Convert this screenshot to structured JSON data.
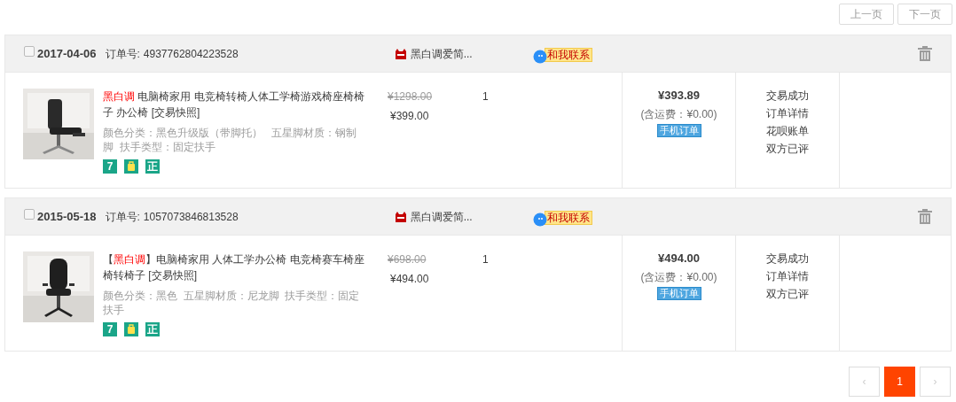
{
  "pager_top": {
    "prev": "上一页",
    "next": "下一页"
  },
  "orders": [
    {
      "checked": false,
      "date": "2017-04-06",
      "order_no_label": "订单号:",
      "order_no": "4937762804223528",
      "shop": "黑白调爱简...",
      "contact": "和我联系",
      "item": {
        "title": {
          "brand": "黑白调",
          "after": " 电脑椅家用 电竞椅转椅人体工学椅游戏椅座椅椅子 办公椅 [交易快照]"
        },
        "specs": "颜色分类：黑色升级版（带脚托）   五星脚材质：钢制脚  扶手类型：固定扶手",
        "services": [
          {
            "kind": "text",
            "label": "7"
          },
          {
            "kind": "bag"
          },
          {
            "kind": "text",
            "label": "正"
          }
        ],
        "original_price": "¥1298.00",
        "price": "¥399.00",
        "qty": "1"
      },
      "total": "¥393.89",
      "shipping": "(含运费：¥0.00)",
      "badge": "手机订单",
      "actions": [
        "交易成功",
        "订单详情",
        "花呗账单",
        "双方已评"
      ]
    },
    {
      "checked": false,
      "date": "2015-05-18",
      "order_no_label": "订单号:",
      "order_no": "1057073846813528",
      "shop": "黑白调爱简...",
      "contact": "和我联系",
      "item": {
        "title": {
          "before": "【",
          "brand": "黑白调",
          "after": "】电脑椅家用 人体工学办公椅 电竞椅赛车椅座椅转椅子 [交易快照]"
        },
        "specs": "颜色分类：黑色  五星脚材质：尼龙脚  扶手类型：固定扶手",
        "services": [
          {
            "kind": "text",
            "label": "7"
          },
          {
            "kind": "bag"
          },
          {
            "kind": "text",
            "label": "正"
          }
        ],
        "original_price": "¥698.00",
        "price": "¥494.00",
        "qty": "1"
      },
      "total": "¥494.00",
      "shipping": "(含运费：¥0.00)",
      "badge": "手机订单",
      "actions": [
        "交易成功",
        "订单详情",
        "双方已评"
      ]
    }
  ],
  "pager_bottom": [
    {
      "label": "‹",
      "selected": false
    },
    {
      "label": "1",
      "selected": true
    },
    {
      "label": "›",
      "selected": false
    }
  ]
}
